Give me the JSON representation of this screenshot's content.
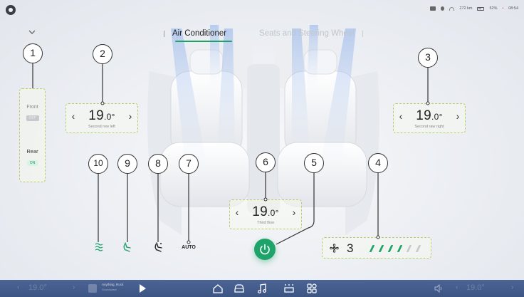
{
  "status_bar": {
    "range": "272 km",
    "battery": "52%",
    "time": "08:54"
  },
  "tabs": [
    {
      "label": "Air Conditioner",
      "active": true
    },
    {
      "label": "Seats and Steering Wheel",
      "active": false
    }
  ],
  "zones": {
    "front": {
      "label": "Front",
      "state": "OFF"
    },
    "rear": {
      "label": "Rear",
      "state": "ON"
    }
  },
  "temps": {
    "second_row_left": {
      "whole": "19",
      "decimal": ".0°",
      "caption": "Second row left"
    },
    "second_row_right": {
      "whole": "19",
      "decimal": ".0°",
      "caption": "Second raw right"
    },
    "third_row": {
      "whole": "19",
      "decimal": ".0°",
      "caption": "Third flow"
    }
  },
  "fan": {
    "level": 3,
    "max_level": 6,
    "label": "3"
  },
  "functions": {
    "auto_label": "AUTO"
  },
  "callouts": [
    "1",
    "2",
    "3",
    "4",
    "5",
    "6",
    "7",
    "8",
    "9",
    "10"
  ],
  "dock": {
    "left_temp": "19.0°",
    "right_temp": "19.0°",
    "media_title": "Anything, Rock",
    "media_sub": "Soundwave"
  },
  "colors": {
    "accent": "#1fa26a",
    "dashed_outline": "#b6cf6a",
    "dock": "#3f5a8a"
  }
}
